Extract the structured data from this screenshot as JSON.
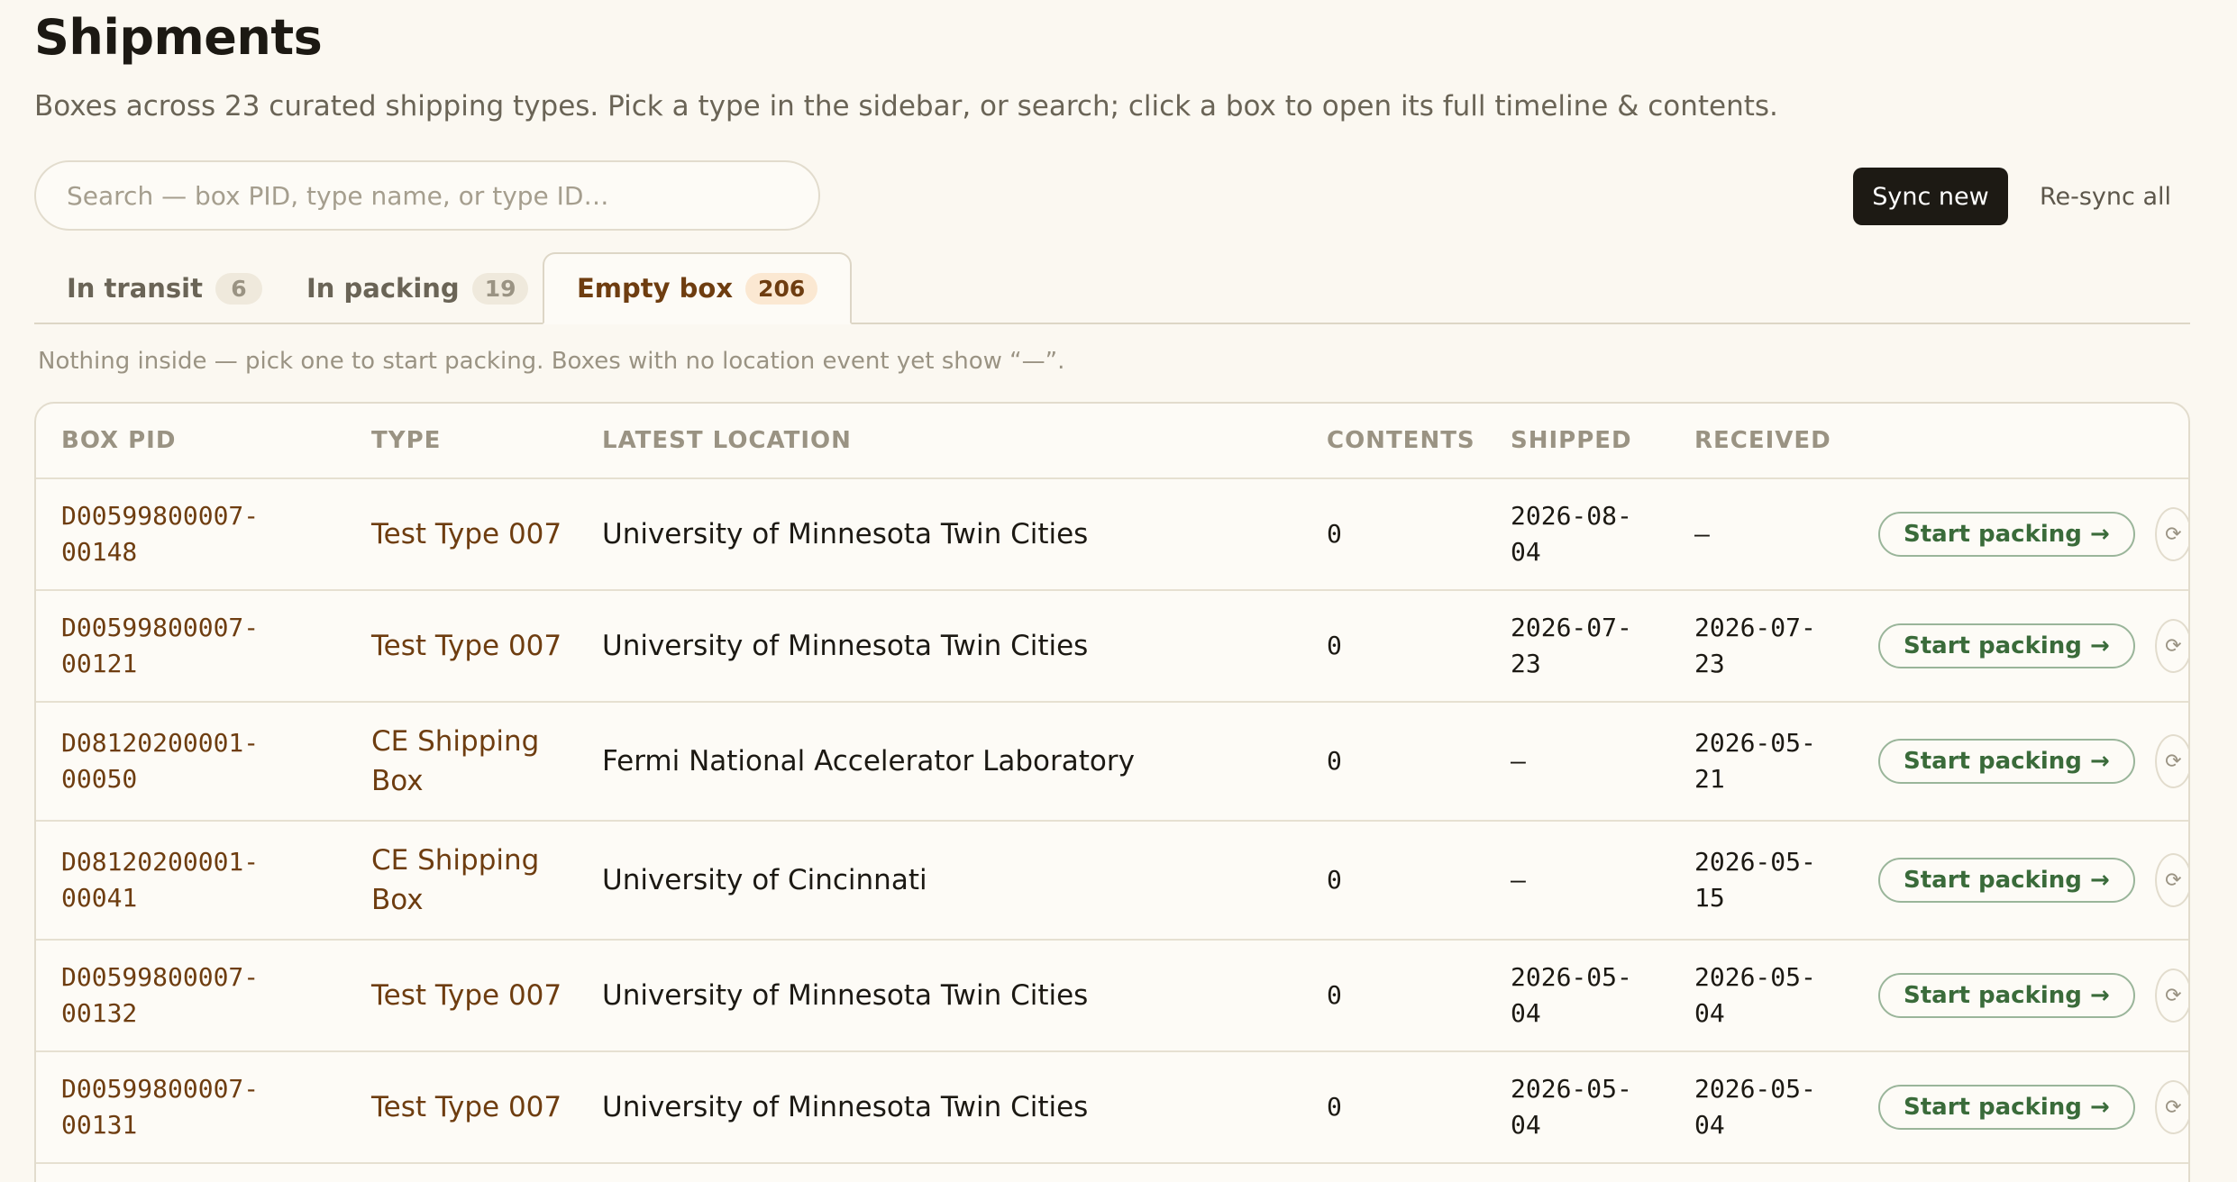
{
  "page": {
    "title": "Shipments",
    "subtitle": "Boxes across 23 curated shipping types. Pick a type in the sidebar, or search; click a box to open its full timeline & contents."
  },
  "search": {
    "placeholder": "Search — box PID, type name, or type ID…",
    "value": ""
  },
  "toolbar": {
    "sync_new_label": "Sync new",
    "resync_all_label": "Re-sync all"
  },
  "tabs": [
    {
      "label": "In transit",
      "count": "6",
      "active": false
    },
    {
      "label": "In packing",
      "count": "19",
      "active": false
    },
    {
      "label": "Empty box",
      "count": "206",
      "active": true
    }
  ],
  "hint": "Nothing inside — pick one to start packing. Boxes with no location event yet show “—”.",
  "table": {
    "headers": [
      "BOX PID",
      "TYPE",
      "LATEST LOCATION",
      "CONTENTS",
      "SHIPPED",
      "RECEIVED"
    ],
    "start_label": "Start packing →",
    "resync_glyph": "⟳",
    "rows": [
      {
        "pid1": "D00599800007-",
        "pid2": "00148",
        "type": "Test Type 007",
        "location": "University of Minnesota Twin Cities",
        "contents": "0",
        "shipped1": "2026-08-",
        "shipped2": "04",
        "received1": "—",
        "received2": ""
      },
      {
        "pid1": "D00599800007-",
        "pid2": "00121",
        "type": "Test Type 007",
        "location": "University of Minnesota Twin Cities",
        "contents": "0",
        "shipped1": "2026-07-",
        "shipped2": "23",
        "received1": "2026-07-",
        "received2": "23"
      },
      {
        "pid1": "D08120200001-",
        "pid2": "00050",
        "type": "CE Shipping Box",
        "location": "Fermi National Accelerator Laboratory",
        "contents": "0",
        "shipped1": "—",
        "shipped2": "",
        "received1": "2026-05-",
        "received2": "21"
      },
      {
        "pid1": "D08120200001-",
        "pid2": "00041",
        "type": "CE Shipping Box",
        "location": "University of Cincinnati",
        "contents": "0",
        "shipped1": "—",
        "shipped2": "",
        "received1": "2026-05-",
        "received2": "15"
      },
      {
        "pid1": "D00599800007-",
        "pid2": "00132",
        "type": "Test Type 007",
        "location": "University of Minnesota Twin Cities",
        "contents": "0",
        "shipped1": "2026-05-",
        "shipped2": "04",
        "received1": "2026-05-",
        "received2": "04"
      },
      {
        "pid1": "D00599800007-",
        "pid2": "00131",
        "type": "Test Type 007",
        "location": "University of Minnesota Twin Cities",
        "contents": "0",
        "shipped1": "2026-05-",
        "shipped2": "04",
        "received1": "2026-05-",
        "received2": "04"
      }
    ]
  }
}
